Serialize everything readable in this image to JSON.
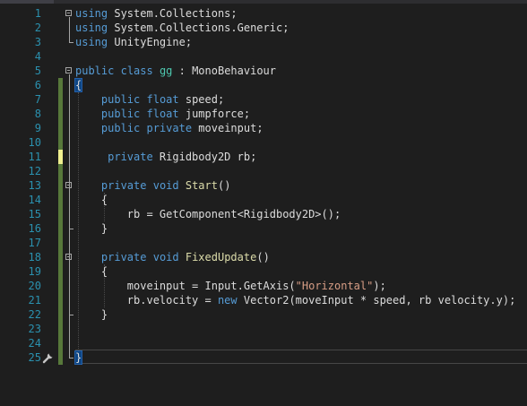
{
  "editor": {
    "line_numbers": [
      "1",
      "2",
      "3",
      "4",
      "5",
      "6",
      "7",
      "8",
      "9",
      "10",
      "11",
      "12",
      "13",
      "14",
      "15",
      "16",
      "17",
      "18",
      "19",
      "20",
      "21",
      "22",
      "23",
      "24",
      "25"
    ],
    "lines": [
      {
        "indent": "",
        "tokens": [
          {
            "t": "using",
            "c": "kw"
          },
          {
            "t": " System.Collections;",
            "c": ""
          }
        ]
      },
      {
        "indent": "",
        "tokens": [
          {
            "t": "using",
            "c": "kw"
          },
          {
            "t": " System.Collections.Generic;",
            "c": ""
          }
        ]
      },
      {
        "indent": "",
        "tokens": [
          {
            "t": "using",
            "c": "kw"
          },
          {
            "t": " UnityEngine;",
            "c": ""
          }
        ]
      },
      {
        "indent": "",
        "tokens": []
      },
      {
        "indent": "",
        "tokens": [
          {
            "t": "public",
            "c": "kw"
          },
          {
            "t": " ",
            "c": ""
          },
          {
            "t": "class",
            "c": "kw"
          },
          {
            "t": " ",
            "c": ""
          },
          {
            "t": "gg",
            "c": "ty"
          },
          {
            "t": " : MonoBehaviour",
            "c": ""
          }
        ]
      },
      {
        "indent": "",
        "tokens": [
          {
            "t": "{",
            "c": "brace"
          }
        ]
      },
      {
        "indent": "    ",
        "tokens": [
          {
            "t": "public",
            "c": "kw"
          },
          {
            "t": " ",
            "c": ""
          },
          {
            "t": "float",
            "c": "kw"
          },
          {
            "t": " speed;",
            "c": ""
          }
        ]
      },
      {
        "indent": "    ",
        "tokens": [
          {
            "t": "public",
            "c": "kw"
          },
          {
            "t": " ",
            "c": ""
          },
          {
            "t": "float",
            "c": "kw"
          },
          {
            "t": " jumpforce;",
            "c": ""
          }
        ]
      },
      {
        "indent": "    ",
        "tokens": [
          {
            "t": "public",
            "c": "kw"
          },
          {
            "t": " ",
            "c": ""
          },
          {
            "t": "private",
            "c": "kw"
          },
          {
            "t": " moveinput;",
            "c": ""
          }
        ]
      },
      {
        "indent": "",
        "tokens": []
      },
      {
        "indent": "     ",
        "tokens": [
          {
            "t": "private",
            "c": "kw"
          },
          {
            "t": " Rigidbody2D rb;",
            "c": ""
          }
        ]
      },
      {
        "indent": "",
        "tokens": []
      },
      {
        "indent": "    ",
        "tokens": [
          {
            "t": "private",
            "c": "kw"
          },
          {
            "t": " ",
            "c": ""
          },
          {
            "t": "void",
            "c": "kw"
          },
          {
            "t": " ",
            "c": ""
          },
          {
            "t": "Start",
            "c": "fn"
          },
          {
            "t": "()",
            "c": ""
          }
        ]
      },
      {
        "indent": "    ",
        "tokens": [
          {
            "t": "{",
            "c": ""
          }
        ]
      },
      {
        "indent": "        ",
        "tokens": [
          {
            "t": "rb = GetComponent<Rigidbody2D>();",
            "c": ""
          }
        ]
      },
      {
        "indent": "    ",
        "tokens": [
          {
            "t": "}",
            "c": ""
          }
        ]
      },
      {
        "indent": "",
        "tokens": []
      },
      {
        "indent": "    ",
        "tokens": [
          {
            "t": "private",
            "c": "kw"
          },
          {
            "t": " ",
            "c": ""
          },
          {
            "t": "void",
            "c": "kw"
          },
          {
            "t": " ",
            "c": ""
          },
          {
            "t": "FixedUpdate",
            "c": "fn"
          },
          {
            "t": "()",
            "c": ""
          }
        ]
      },
      {
        "indent": "    ",
        "tokens": [
          {
            "t": "{",
            "c": ""
          }
        ]
      },
      {
        "indent": "        ",
        "tokens": [
          {
            "t": "moveinput = Input.GetAxis(",
            "c": ""
          },
          {
            "t": "\"Horizontal\"",
            "c": "str"
          },
          {
            "t": ");",
            "c": ""
          }
        ]
      },
      {
        "indent": "        ",
        "tokens": [
          {
            "t": "rb.velocity = ",
            "c": ""
          },
          {
            "t": "new",
            "c": "kw"
          },
          {
            "t": " Vector2(moveInput * speed, rb velocity.y);",
            "c": ""
          }
        ]
      },
      {
        "indent": "    ",
        "tokens": [
          {
            "t": "}",
            "c": ""
          }
        ]
      },
      {
        "indent": "",
        "tokens": []
      },
      {
        "indent": "",
        "tokens": []
      },
      {
        "indent": "",
        "tokens": [
          {
            "t": "}",
            "c": "brace"
          }
        ]
      }
    ],
    "changed_lines": [
      6,
      7,
      8,
      9,
      10,
      11,
      12,
      13,
      14,
      15,
      16,
      17,
      18,
      19,
      20,
      21,
      22,
      23,
      24,
      25
    ],
    "modified_unsaved_lines": [
      11
    ],
    "fold_lines": [
      1,
      5,
      13,
      18
    ],
    "current_line": 25,
    "icons": {
      "quick_action": "screwdriver-lightbulb-icon"
    },
    "colors": {
      "background": "#1e1e1e",
      "line_number": "#2b91af",
      "keyword": "#569cd6",
      "type": "#4ec9b0",
      "method": "#dcdcaa",
      "string": "#d69d85",
      "text": "#dcdcdc",
      "saved_change": "#57783a",
      "unsaved_change": "#efef8f"
    }
  }
}
